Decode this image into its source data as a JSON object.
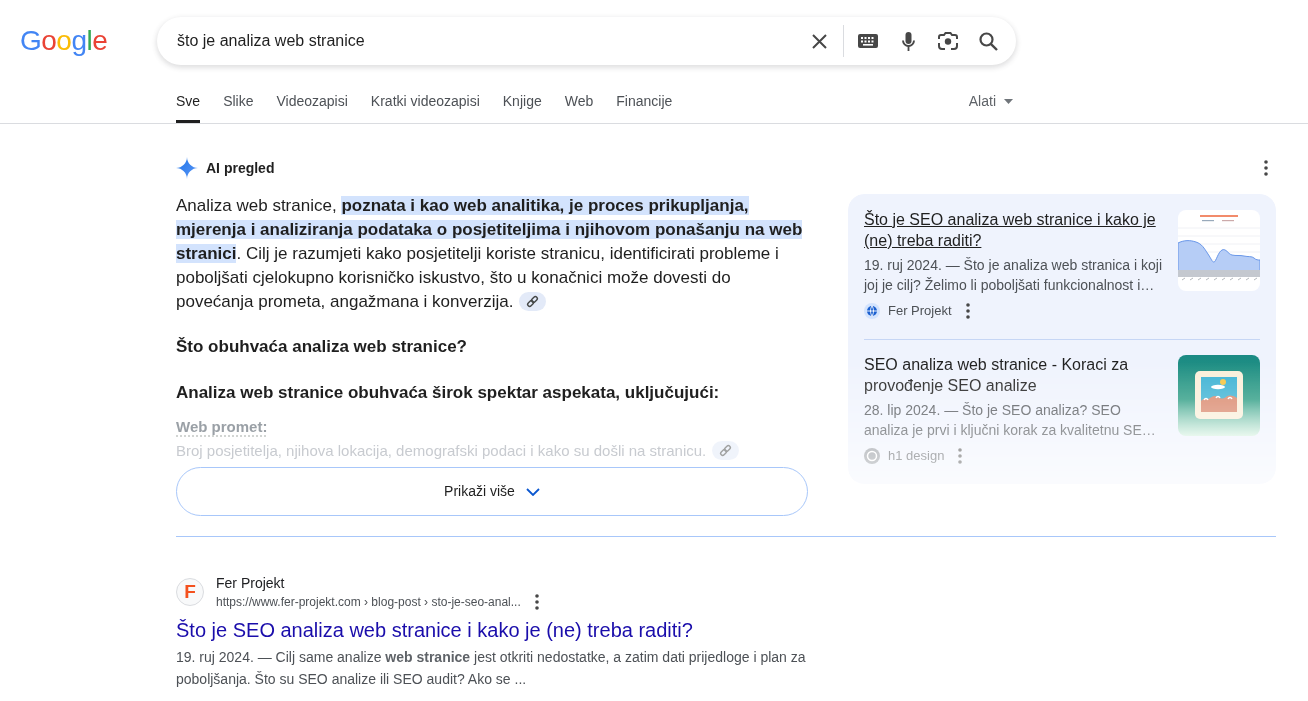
{
  "logo": {
    "text": "Google"
  },
  "search": {
    "value": "što je analiza web stranice"
  },
  "tabs": [
    {
      "label": "Sve",
      "selected": true
    },
    {
      "label": "Slike",
      "selected": false
    },
    {
      "label": "Videozapisi",
      "selected": false
    },
    {
      "label": "Kratki videozapisi",
      "selected": false
    },
    {
      "label": "Knjige",
      "selected": false
    },
    {
      "label": "Web",
      "selected": false
    },
    {
      "label": "Financije",
      "selected": false
    }
  ],
  "tools": {
    "label": "Alati"
  },
  "ai_overview": {
    "title": "AI pregled",
    "expanded": false,
    "paragraph": [
      {
        "text": "Analiza web stranice, ",
        "highlighted": false
      },
      {
        "text": "poznata i kao web analitika, je proces prikupljanja, mjerenja i analiziranja podataka o posjetiteljima i njihovom ponašanju na web stranici",
        "highlighted": true
      },
      {
        "text": ". Cilj je razumjeti kako posjetitelji koriste stranicu, identificirati probleme i poboljšati cjelokupno korisničko iskustvo, što u konačnici može dovesti do povećanja prometa, angažmana i konverzija.",
        "highlighted": false
      }
    ],
    "heading": "Što obuhvaća analiza web stranice?",
    "subheading": "Analiza web stranice obuhvaća širok spektar aspekata, uključujući:",
    "items": [
      {
        "term": "Web promet:",
        "description": "Broj posjetitelja, njihova lokacija, demografski podaci i kako su došli na stranicu."
      }
    ],
    "show_more": "Prikaži više",
    "sources": [
      {
        "title": "Što je SEO analiza web stranice i kako je (ne) treba raditi?",
        "hovered": true,
        "snippet": "19. ruj 2024. — Što je analiza web stranica i koji joj je cilj? Želimo li poboljšati funkcionalnost i…",
        "site": "Fer Projekt",
        "site_icon": {
          "kind": "globe"
        },
        "thumbnail": {
          "kind": "chart"
        }
      },
      {
        "title": "SEO analiza web stranice - Koraci za provođenje SEO analize",
        "hovered": false,
        "snippet": "28. lip 2024. — Što je SEO analiza? SEO analiza je prvi i ključni korak za kvalitetnu SE…",
        "site": "h1 design",
        "site_icon": {
          "kind": "logo"
        },
        "thumbnail": {
          "kind": "illustration"
        }
      }
    ]
  },
  "results": [
    {
      "logo_text": "F",
      "site": "Fer Projekt",
      "url": "https://www.fer-projekt.com › blog-post › sto-je-seo-anal...",
      "title": "Što je SEO analiza web stranice i kako je (ne) treba raditi?",
      "snippet": "19. ruj 2024. — Cilj same analize **web stranice** jest otkriti nedostatke, a zatim dati prijedloge i plan za poboljšanja. Što su SEO analize ili SEO audit? Ako se ..."
    }
  ]
}
